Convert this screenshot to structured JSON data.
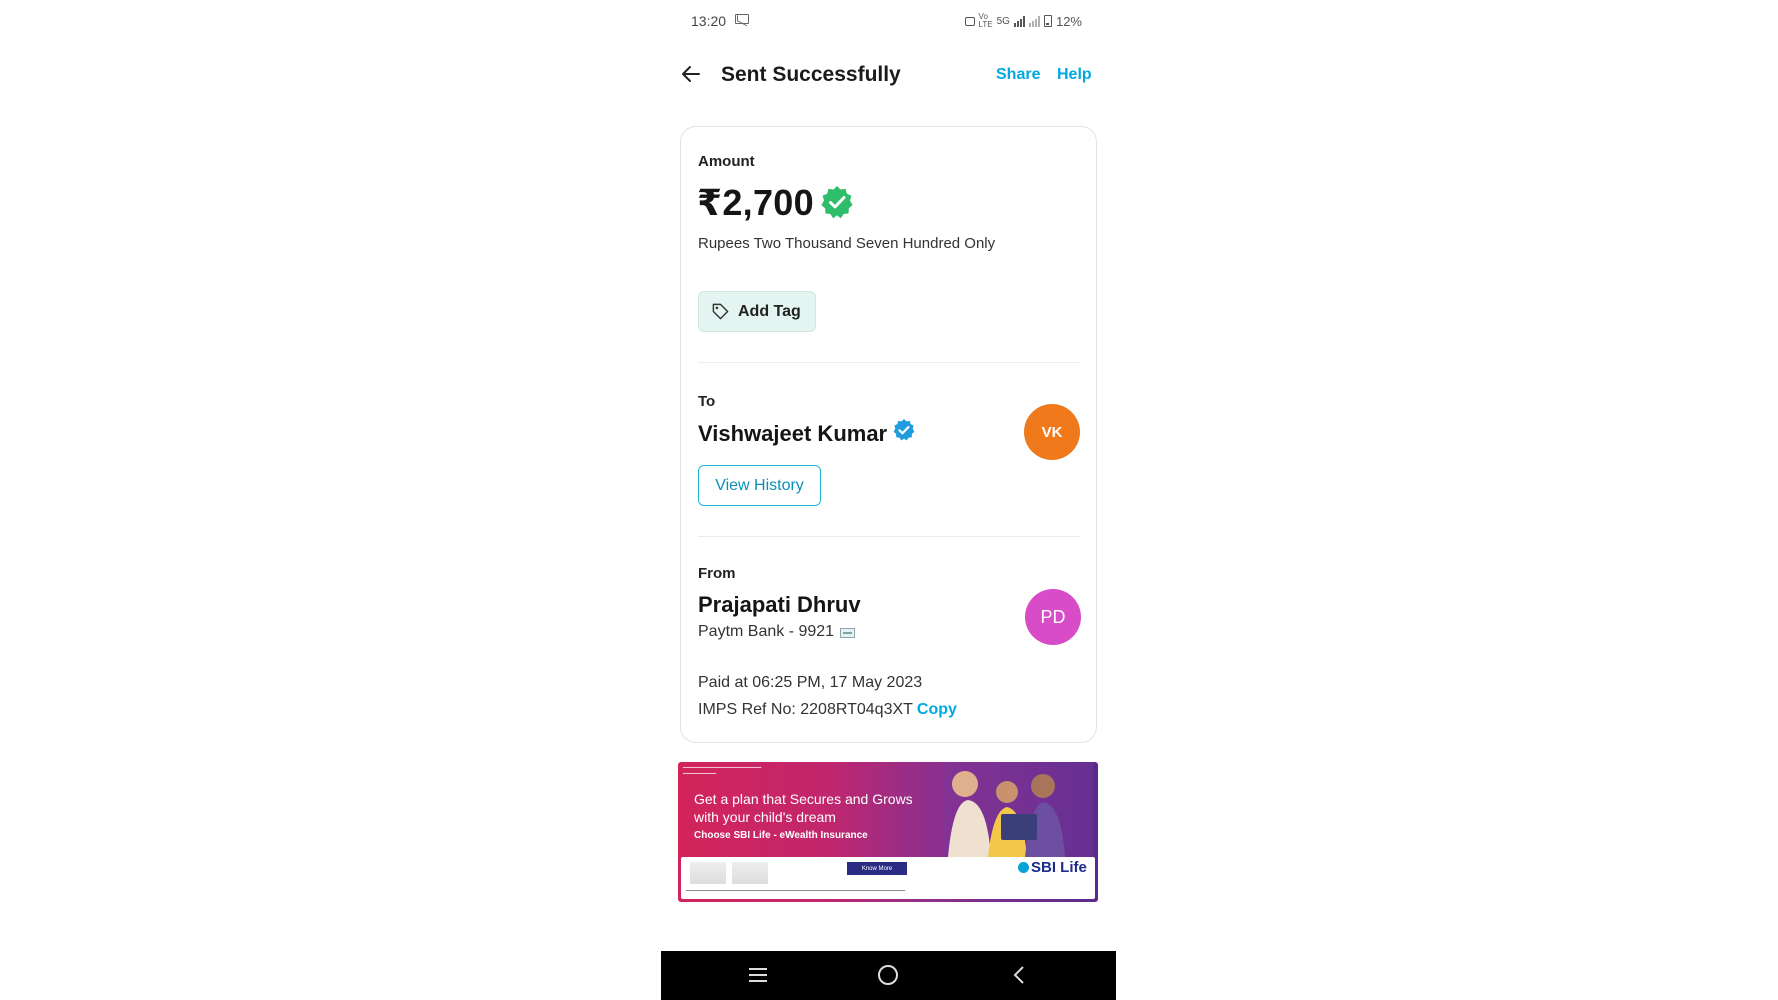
{
  "status_bar": {
    "time": "13:20",
    "network": "5G",
    "battery": "12%"
  },
  "header": {
    "title": "Sent Successfully",
    "share": "Share",
    "help": "Help"
  },
  "amount_section": {
    "label": "Amount",
    "amount": "₹2,700",
    "amount_in_words": "Rupees Two Thousand Seven Hundred Only",
    "add_tag": "Add Tag"
  },
  "to_section": {
    "label": "To",
    "name": "Vishwajeet Kumar",
    "initials": "VK",
    "view_history": "View History"
  },
  "from_section": {
    "label": "From",
    "name": "Prajapati Dhruv",
    "initials": "PD",
    "bank": "Paytm Bank - 9921"
  },
  "details": {
    "paid_at": "Paid at 06:25 PM, 17 May 2023",
    "imps_ref": "IMPS Ref No: 2208RT04q3XT",
    "copy": "Copy"
  },
  "ad_banner": {
    "headline": "Get a plan that Secures and Grows with your child's dream",
    "subline": "Choose SBI Life - eWealth Insurance",
    "cta": "Know More",
    "brand": "SBI Life"
  },
  "colors": {
    "accent": "#00a9e0",
    "success_green": "#2ebd6b",
    "verified_blue": "#1f9be0",
    "avatar_vk": "#f07a1b",
    "avatar_pd": "#d84cc7"
  },
  "icons": {
    "back": "arrow-left-icon",
    "verified_amount": "verified-badge-icon",
    "tag": "tag-icon",
    "verified_user": "verified-badge-icon",
    "bank": "bank-card-icon"
  }
}
